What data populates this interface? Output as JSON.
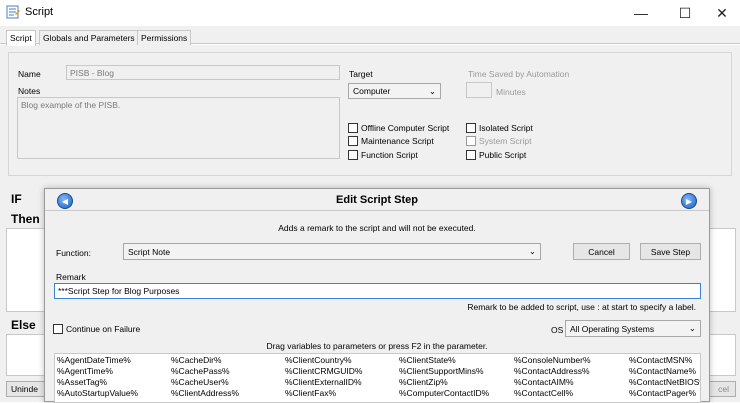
{
  "window": {
    "title": "Script",
    "controls": {
      "minimize": "—",
      "maximize": "☐",
      "close": "✕"
    }
  },
  "tabs": [
    {
      "label": "Script",
      "active": true
    },
    {
      "label": "Globals and Parameters",
      "active": false
    },
    {
      "label": "Permissions",
      "active": false
    }
  ],
  "script_form": {
    "name_label": "Name",
    "name_value": "PISB - Blog",
    "notes_label": "Notes",
    "notes_value": "Blog example of the PISB.",
    "target_label": "Target",
    "target_value": "Computer",
    "time_saved_label": "Time Saved by Automation",
    "minutes_label": "Minutes",
    "checkboxes": {
      "offline": "Offline Computer Script",
      "maintenance": "Maintenance Script",
      "function": "Function Script",
      "isolated": "Isolated Script",
      "system": "System Script",
      "public": "Public Script"
    }
  },
  "sections": {
    "if": "IF",
    "then": "Then",
    "else": "Else"
  },
  "bottom_left_button": "Uninde",
  "bottom_right_button": "cel",
  "dialog": {
    "title": "Edit Script Step",
    "description": "Adds a remark to the script and will not be executed.",
    "function_label": "Function:",
    "function_value": "Script Note",
    "cancel_label": "Cancel",
    "save_label": "Save Step",
    "remark_label": "Remark",
    "remark_value": "***Script Step for Blog Purposes",
    "remark_hint": "Remark to be added to script, use : at start to specify a label.",
    "continue_on_failure": "Continue on Failure",
    "os_label": "OS",
    "os_value": "All Operating Systems",
    "drag_hint": "Drag variables to parameters or press F2 in the parameter.",
    "variables": [
      [
        "%AgentDateTime%",
        "%CacheDir%",
        "%ClientCountry%",
        "%ClientState%",
        "%ConsoleNumber%",
        "%ContactMSN%"
      ],
      [
        "%AgentTime%",
        "%CachePass%",
        "%ClientCRMGUID%",
        "%ClientSupportMins%",
        "%ContactAddress%",
        "%ContactName%"
      ],
      [
        "%AssetTag%",
        "%CacheUser%",
        "%ClientExternalID%",
        "%ClientZip%",
        "%ContactAIM%",
        "%ContactNetBIOS%"
      ],
      [
        "%AutoStartupValue%",
        "%ClientAddress%",
        "%ClientFax%",
        "%ComputerContactID%",
        "%ContactCell%",
        "%ContactPager%"
      ]
    ]
  }
}
